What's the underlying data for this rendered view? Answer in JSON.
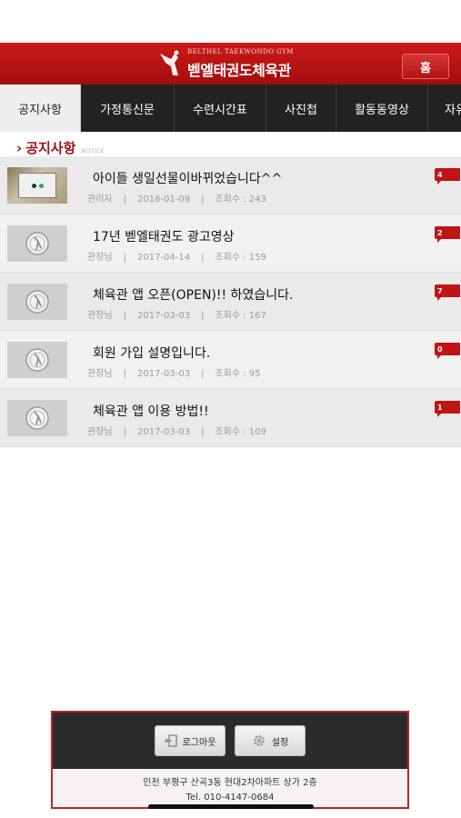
{
  "header": {
    "brand_en": "BELTHEL TAEKWONDO GYM",
    "brand_ko": "벧엘태권도체육관",
    "home_label": "홈",
    "logo_icon": "taekwondo-kick-logo-icon"
  },
  "tabs": [
    {
      "label": "공지사항",
      "active": true
    },
    {
      "label": "가정통신문",
      "active": false
    },
    {
      "label": "수련시간표",
      "active": false
    },
    {
      "label": "사진첩",
      "active": false
    },
    {
      "label": "활동동영상",
      "active": false
    },
    {
      "label": "자유",
      "active": false
    }
  ],
  "section": {
    "title": "공지사항",
    "subtitle": "NOTICE"
  },
  "posts": [
    {
      "title": "아이들 생일선물이바뀌었습니다^^",
      "author": "관리자",
      "date": "2018-01-09",
      "views": "조회수 : 243",
      "comments": "4",
      "thumb": "photo"
    },
    {
      "title": "17년 벧엘태권도 광고영상",
      "author": "관장님",
      "date": "2017-04-14",
      "views": "조회수 : 159",
      "comments": "2",
      "thumb": "logo"
    },
    {
      "title": "체육관 앱 오픈(OPEN)!! 하였습니다.",
      "author": "관장님",
      "date": "2017-03-03",
      "views": "조회수 : 167",
      "comments": "7",
      "thumb": "logo"
    },
    {
      "title": "회원 가입 설명입니다.",
      "author": "관장님",
      "date": "2017-03-03",
      "views": "조회수 : 95",
      "comments": "0",
      "thumb": "logo"
    },
    {
      "title": "체육관 앱 이용 방법!!",
      "author": "관장님",
      "date": "2017-03-03",
      "views": "조회수 : 109",
      "comments": "1",
      "thumb": "logo"
    }
  ],
  "footer": {
    "logout_label": "로그아웃",
    "settings_label": "설정",
    "address": "인천 부평구 산곡3동 현대2차아파트 상가 2층",
    "tel": "Tel. 010-4147-0684"
  },
  "colors": {
    "brand_red": "#b51414",
    "tab_bg": "#222222"
  }
}
